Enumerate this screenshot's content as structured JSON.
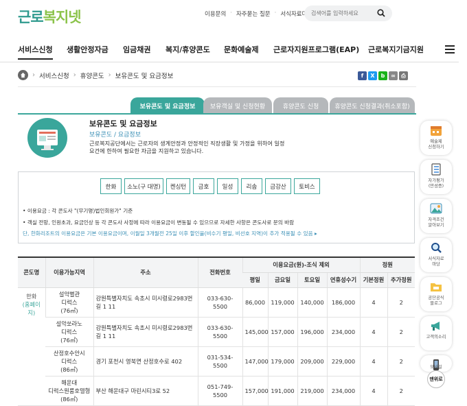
{
  "brand": {
    "logo_main": "근로",
    "logo_accent": "복지넷"
  },
  "toplinks": [
    "이용문의",
    "자주묻는 질문",
    "서식자료마당"
  ],
  "search": {
    "placeholder": "검색어를 입력하세요"
  },
  "gnb": [
    "서비스신청",
    "생활안정자금",
    "임금채권",
    "복지/휴양콘도",
    "문화예술제",
    "근로자지원프로그램(EAP)",
    "근로복지기금지원"
  ],
  "breadcrumb": [
    "서비스신청",
    "휴양콘도",
    "보유콘도 및 요금정보"
  ],
  "share": [
    {
      "label": "f",
      "color": "#3b5998"
    },
    {
      "label": "X",
      "color": "#1d9bf0"
    },
    {
      "label": "b",
      "color": "#19b219"
    },
    {
      "label": "∞",
      "color": "#888888"
    },
    {
      "label": "⎙",
      "color": "#777777"
    }
  ],
  "tabs": [
    "보유콘도 및 요금정보",
    "보유객실 및 신청현황",
    "휴양콘도 신청",
    "휴양콘도 신청결과(취소포함)"
  ],
  "intro": {
    "title": "보유콘도 및 요금정보",
    "subtitle": "보유콘도 / 요금정보",
    "desc": "근로복지공단에서는 근로자의 생계안정과 안정적인 직장생활 및 가정을 위하여 일정요건에 한하여 필요한 자금을 지원하고 있습니다."
  },
  "condo_buttons": [
    "한화",
    "소노(구 대명)",
    "켄싱턴",
    "금호",
    "일성",
    "리솜",
    "금강산",
    "토비스"
  ],
  "notes": [
    "• 이용요금 : 각 콘도사 \"(무기명)법인회원가\" 기준",
    "• 객실 전망, 인원초과, 요금인상 등 각 콘도사 사정에 따라 이용요금이 변동될 수 있으므로 자세한 사항은 콘도사로 문의 바람",
    "단, 한화리조트의 이용요금은 기본 이용요금이며, 이월일 3개월전 25일 이후 할인율(비수기 평일, 비선호 지역)이 추가 적용될 수 있음 ▸"
  ],
  "table": {
    "headers": [
      "콘도명",
      "이용가능지역",
      "주소",
      "전화번호",
      "이용요금(원)-조식 제외",
      "정원"
    ],
    "subheaders": [
      "평일",
      "금요일",
      "토요일",
      "연휴성수기",
      "기본정원",
      "추가정원"
    ],
    "condo_name": "한화",
    "condo_link": "(홈페이지)",
    "rows": [
      {
        "region": "설악별관\n디럭스\n(76㎡)",
        "addr": "강원특별자치도 속초시 미시령로2983번길 1 11",
        "phone": "033-630-5500",
        "weekday": "86,000",
        "fri": "119,000",
        "sat": "140,000",
        "peak": "186,000",
        "base": "4",
        "extra": "2"
      },
      {
        "region": "설악쏘라노\n디럭스\n(76㎡)",
        "addr": "강원특별자치도 속초시 미시령로2983번길 1 11",
        "phone": "033-630-5500",
        "weekday": "145,000",
        "fri": "157,000",
        "sat": "196,000",
        "peak": "234,000",
        "base": "4",
        "extra": "2"
      },
      {
        "region": "산정호수안시\n디럭스\n(86㎡)",
        "addr": "경기 포천시 영북면 산정호수로 402",
        "phone": "031-534-5500",
        "weekday": "147,000",
        "fri": "179,000",
        "sat": "209,000",
        "peak": "229,000",
        "base": "4",
        "extra": "2"
      },
      {
        "region": "해운대\n디럭스원룸호텔형\n(86㎡)",
        "addr": "부산 해운대구 마린시티3로 52",
        "phone": "051-749-5500",
        "weekday": "157,000",
        "fri": "191,000",
        "sat": "219,000",
        "peak": "234,000",
        "base": "4",
        "extra": "2"
      }
    ]
  },
  "quick_menu": [
    {
      "icon": "calendar-icon",
      "label": "예술제\n신청하기"
    },
    {
      "icon": "checklist-icon",
      "label": "자가평가\n(만성증)"
    },
    {
      "icon": "photo-icon",
      "label": "자격조건\n알아보기"
    },
    {
      "icon": "search-icon",
      "label": "서식자료\n마당"
    },
    {
      "icon": "folder-icon",
      "label": "공단공식\n블로그"
    },
    {
      "icon": "megaphone-icon",
      "label": "고객의소리"
    },
    {
      "icon": "mobile-icon",
      "label": "모바일"
    }
  ],
  "quick_top": "맨위로"
}
